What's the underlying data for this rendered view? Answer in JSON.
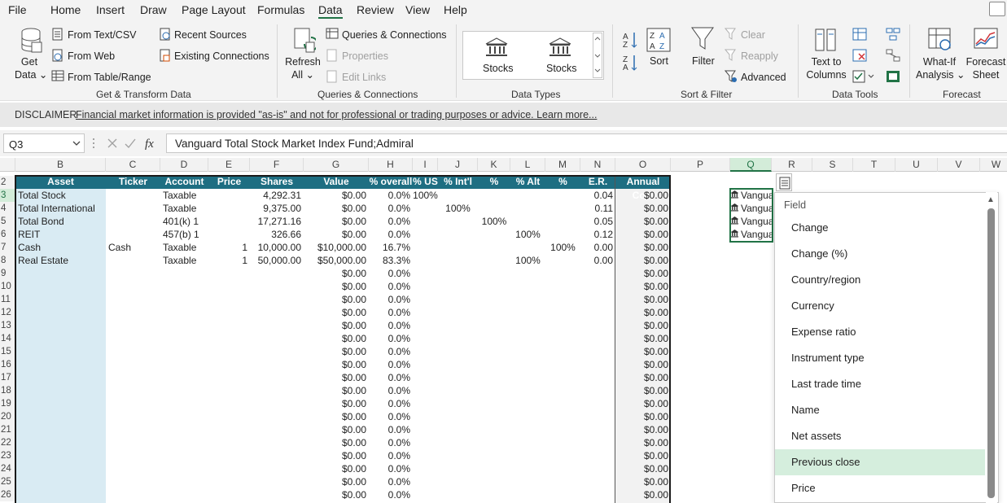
{
  "menu": {
    "items": [
      "File",
      "Home",
      "Insert",
      "Draw",
      "Page Layout",
      "Formulas",
      "Data",
      "Review",
      "View",
      "Help"
    ],
    "active": "Data"
  },
  "ribbon": {
    "get_transform": {
      "get_data": [
        "Get",
        "Data ⌄"
      ],
      "from_text_csv": "From Text/CSV",
      "from_web": "From Web",
      "from_table_range": "From Table/Range",
      "recent_sources": "Recent Sources",
      "existing_connections": "Existing Connections",
      "label": "Get & Transform Data"
    },
    "queries": {
      "refresh_all": [
        "Refresh",
        "All ⌄"
      ],
      "queries_connections": "Queries & Connections",
      "properties": "Properties",
      "edit_links": "Edit Links",
      "label": "Queries & Connections"
    },
    "data_types": {
      "stocks1": "Stocks",
      "stocks2": "Stocks",
      "label": "Data Types"
    },
    "sort_filter": {
      "sort": "Sort",
      "filter": "Filter",
      "clear": "Clear",
      "reapply": "Reapply",
      "advanced": "Advanced",
      "label": "Sort & Filter"
    },
    "data_tools": {
      "text_to_columns": [
        "Text to",
        "Columns"
      ],
      "label": "Data Tools"
    },
    "forecast": {
      "what_if": [
        "What-If",
        "Analysis ⌄"
      ],
      "forecast_sheet": [
        "Forecast",
        "Sheet"
      ],
      "label": "Forecast"
    }
  },
  "disclaimer": {
    "label": "DISCLAIMER",
    "text": "Financial market information is provided \"as-is\" and not for professional or trading purposes or advice. Learn more..."
  },
  "formula_bar": {
    "name_box": "Q3",
    "formula": "Vanguard Total Stock Market Index Fund;Admiral"
  },
  "columns": [
    "B",
    "C",
    "D",
    "E",
    "F",
    "G",
    "H",
    "I",
    "J",
    "K",
    "L",
    "M",
    "N",
    "O",
    "P",
    "Q",
    "R",
    "S",
    "T",
    "U",
    "V",
    "W"
  ],
  "selected_column": "Q",
  "selected_row": "3",
  "table": {
    "headers": [
      "Asset",
      "Ticker",
      "Account",
      "Price",
      "Shares",
      "Value",
      "% overall",
      "% US",
      "% Int'l",
      "% Bond",
      "% Alt",
      "% Cash",
      "E.R.",
      "Annual Cost"
    ],
    "rows": [
      [
        "Total Stock",
        "",
        "Taxable",
        "",
        "4,292.31",
        "$0.00",
        "0.0%",
        "100%",
        "",
        "",
        "",
        "",
        "0.04",
        "$0.00"
      ],
      [
        "Total International",
        "",
        "Taxable",
        "",
        "9,375.00",
        "$0.00",
        "0.0%",
        "",
        "100%",
        "",
        "",
        "",
        "0.11",
        "$0.00"
      ],
      [
        "Total Bond",
        "",
        "401(k) 1",
        "",
        "17,271.16",
        "$0.00",
        "0.0%",
        "",
        "",
        "100%",
        "",
        "",
        "0.05",
        "$0.00"
      ],
      [
        "REIT",
        "",
        "457(b) 1",
        "",
        "326.66",
        "$0.00",
        "0.0%",
        "",
        "",
        "",
        "100%",
        "",
        "0.12",
        "$0.00"
      ],
      [
        "Cash",
        "Cash",
        "Taxable",
        "1",
        "10,000.00",
        "$10,000.00",
        "16.7%",
        "",
        "",
        "",
        "",
        "100%",
        "0.00",
        "$0.00"
      ],
      [
        "Real Estate",
        "",
        "Taxable",
        "1",
        "50,000.00",
        "$50,000.00",
        "83.3%",
        "",
        "",
        "",
        "100%",
        "",
        "0.00",
        "$0.00"
      ]
    ],
    "empty_value": "$0.00",
    "empty_pct": "0.0%",
    "empty_cost": "$0.00"
  },
  "row_numbers": [
    "2",
    "3",
    "4",
    "5",
    "6",
    "7",
    "8",
    "9",
    "10",
    "11",
    "12",
    "13",
    "14",
    "15",
    "16",
    "17",
    "18",
    "19",
    "20",
    "21",
    "22",
    "23",
    "24",
    "25",
    "26"
  ],
  "q_cells": [
    "Vangua",
    "Vangua",
    "Vangua",
    "Vangua"
  ],
  "field_panel": {
    "title": "Field",
    "items": [
      "Change",
      "Change (%)",
      "Country/region",
      "Currency",
      "Expense ratio",
      "Instrument type",
      "Last trade time",
      "Name",
      "Net assets",
      "Previous close",
      "Price"
    ],
    "highlighted": "Previous close"
  },
  "colors": {
    "accent": "#217346",
    "table_header": "#1e6e82",
    "asset_column": "#d9ebf3",
    "highlight": "#d5eedd"
  }
}
